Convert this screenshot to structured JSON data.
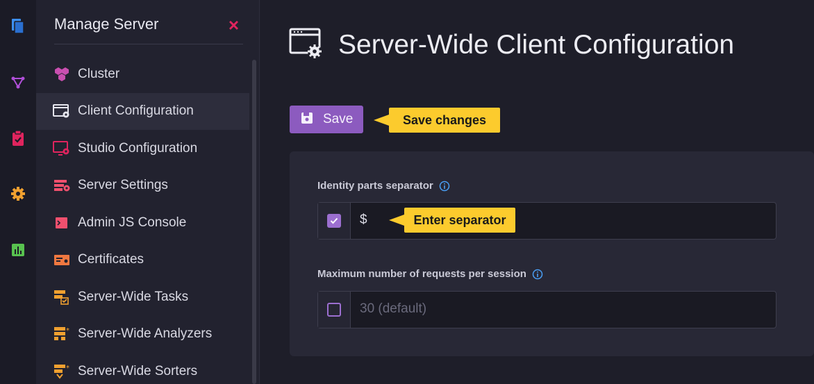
{
  "rail": {
    "icons": [
      "documents-icon",
      "graph-icon",
      "clipboard-check-icon",
      "gear-icon",
      "stats-icon"
    ],
    "colors": [
      "#3d8ff0",
      "#b04fd8",
      "#e0245e",
      "#f0a030",
      "#58c24f"
    ]
  },
  "menu": {
    "title": "Manage Server",
    "close_icon": "close-icon",
    "items": [
      {
        "label": "Cluster",
        "icon": "cluster-icon",
        "color": "#c94fb0"
      },
      {
        "label": "Client Configuration",
        "icon": "client-config-icon",
        "color": "#e6e6ee",
        "active": true
      },
      {
        "label": "Studio Configuration",
        "icon": "studio-config-icon",
        "color": "#e0245e"
      },
      {
        "label": "Server Settings",
        "icon": "server-settings-icon",
        "color": "#f0506e"
      },
      {
        "label": "Admin JS Console",
        "icon": "console-icon",
        "color": "#f0506e"
      },
      {
        "label": "Certificates",
        "icon": "certificate-icon",
        "color": "#f07840"
      },
      {
        "label": "Server-Wide Tasks",
        "icon": "tasks-icon",
        "color": "#f0a030"
      },
      {
        "label": "Server-Wide Analyzers",
        "icon": "analyzers-icon",
        "color": "#f0a030"
      },
      {
        "label": "Server-Wide Sorters",
        "icon": "sorters-icon",
        "color": "#f0a030"
      }
    ]
  },
  "main": {
    "title": "Server-Wide Client Configuration",
    "save_label": "Save",
    "save_callout": "Save changes",
    "fields": [
      {
        "label": "Identity parts separator",
        "checked": true,
        "value": "$",
        "callout": "Enter separator"
      },
      {
        "label": "Maximum number of requests per session",
        "checked": false,
        "placeholder": "30 (default)"
      }
    ]
  },
  "colors": {
    "accent": "#8c5bbf",
    "callout": "#fccb2d",
    "info": "#4a9ff5"
  }
}
